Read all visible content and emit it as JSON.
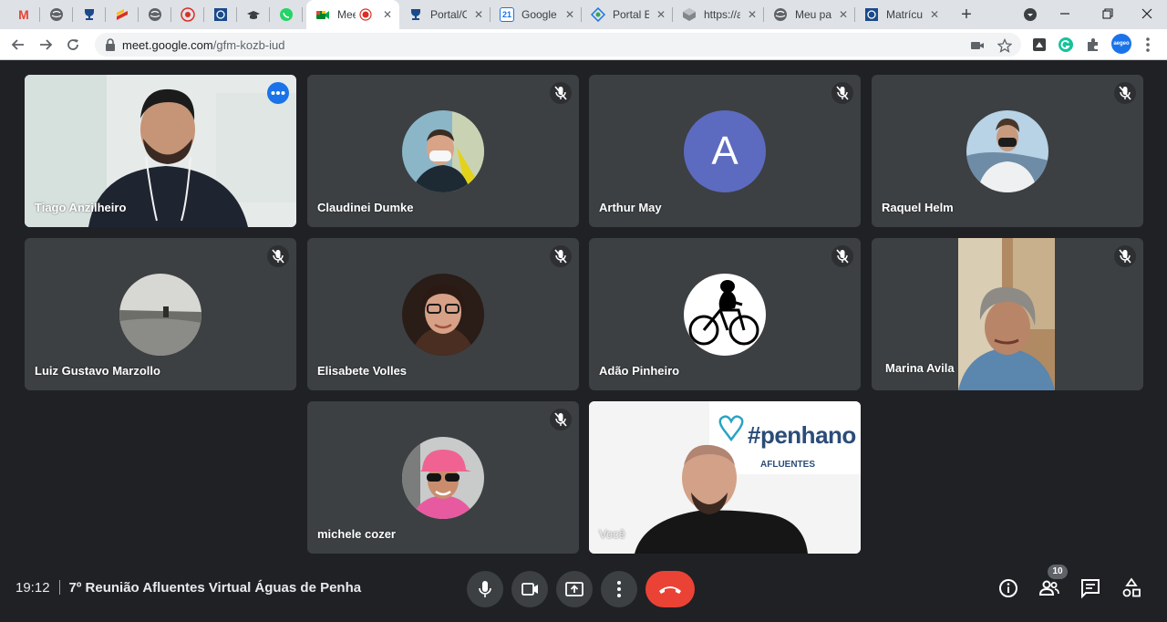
{
  "browser": {
    "pinned_tabs": [
      {
        "icon": "gmail-icon",
        "glyph": "M",
        "color": "#ea4335"
      },
      {
        "icon": "globe-icon",
        "glyph": "",
        "color": "#5f6368"
      },
      {
        "icon": "trophy-icon",
        "glyph": "",
        "color": "#1a4a8a"
      },
      {
        "icon": "flag-icon",
        "glyph": "",
        "color": "#d93025"
      },
      {
        "icon": "globe-icon",
        "glyph": "",
        "color": "#5f6368"
      },
      {
        "icon": "seal-icon",
        "glyph": "",
        "color": "#d93025"
      },
      {
        "icon": "shield-logo-icon",
        "glyph": "",
        "color": "#1a4a8a"
      },
      {
        "icon": "graduation-cap-icon",
        "glyph": "",
        "color": "#3c4043"
      },
      {
        "icon": "whatsapp-icon",
        "glyph": "",
        "color": "#25d366"
      }
    ],
    "tabs": [
      {
        "label": "Meet",
        "active": true
      },
      {
        "label": "Portal/C",
        "active": false
      },
      {
        "label": "Google",
        "active": false
      },
      {
        "label": "Portal E",
        "active": false
      },
      {
        "label": "https://a",
        "active": false
      },
      {
        "label": "Meu pa",
        "active": false
      },
      {
        "label": "Matrícu",
        "active": false
      }
    ],
    "calendar_day": "21",
    "url_host": "meet.google.com",
    "url_path": "/gfm-kozb-iud",
    "profile_text": "aegeo"
  },
  "meet": {
    "participants": [
      {
        "name": "Tiago Anzilheiro",
        "kind": "video",
        "muted": false,
        "speaking": true
      },
      {
        "name": "Claudinei Dumke",
        "kind": "photo",
        "muted": true
      },
      {
        "name": "Arthur May",
        "kind": "letter",
        "letter": "A",
        "muted": true
      },
      {
        "name": "Raquel Helm",
        "kind": "photo",
        "muted": true
      },
      {
        "name": "Luiz Gustavo Marzollo",
        "kind": "photo",
        "muted": true
      },
      {
        "name": "Elisabete Volles",
        "kind": "photo",
        "muted": true
      },
      {
        "name": "Adão Pinheiro",
        "kind": "photo",
        "muted": true
      },
      {
        "name": "Marina Avila",
        "kind": "video",
        "muted": true
      },
      {
        "name": "michele cozer",
        "kind": "photo",
        "muted": true
      },
      {
        "name": "Você",
        "kind": "video",
        "muted": false
      }
    ],
    "self_banner_text": "#penhano",
    "self_banner_sub": "AFLUENTES",
    "time": "19:12",
    "meeting_title": "7º Reunião Afluentes Virtual Águas de Penha",
    "participant_count": "10",
    "accent_color": "#8ab4f8",
    "end_call_color": "#ea4335"
  }
}
